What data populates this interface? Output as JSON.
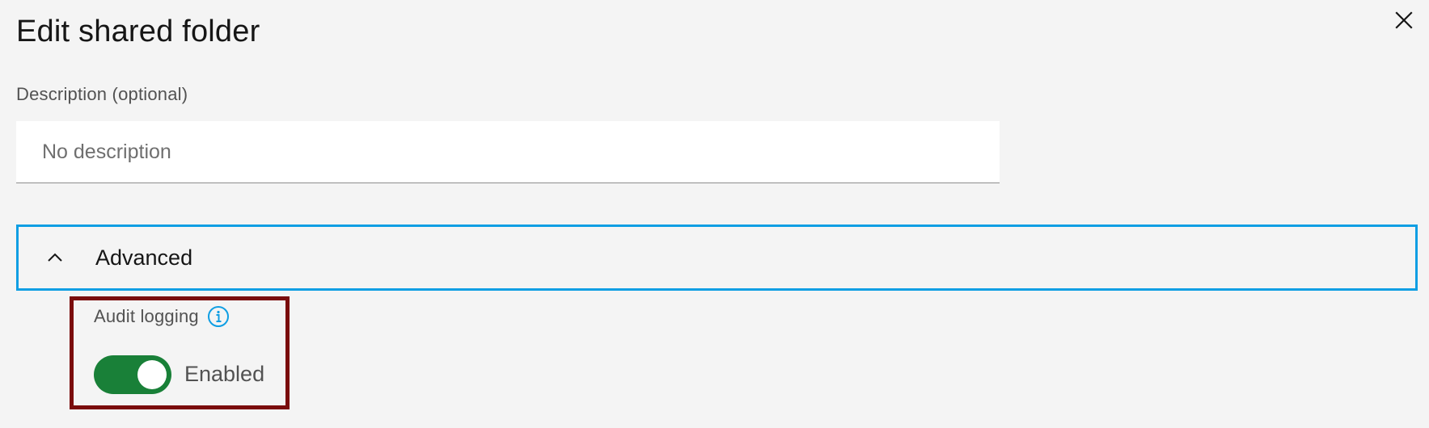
{
  "modal": {
    "title": "Edit shared folder",
    "close_icon": "close-icon"
  },
  "description": {
    "label": "Description (optional)",
    "value": "",
    "placeholder": "No description"
  },
  "advanced": {
    "title": "Advanced",
    "expanded": true,
    "chevron_icon": "chevron-up-icon",
    "focus_color": "#0f9ee3"
  },
  "audit_logging": {
    "label": "Audit logging",
    "info_icon": "info-icon",
    "toggle_on": true,
    "toggle_label": "Enabled",
    "toggle_color": "#198038",
    "highlight_color": "#7a0c0c"
  }
}
